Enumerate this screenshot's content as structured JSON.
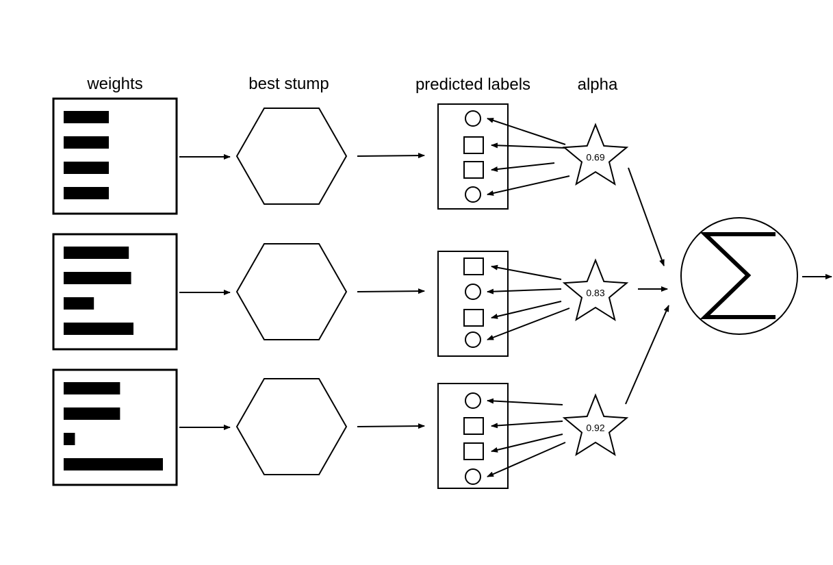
{
  "headers": {
    "weights": "weights",
    "best_stump": "best stump",
    "predicted_labels": "predicted labels",
    "alpha": "alpha"
  },
  "rounds": [
    {
      "weights": [
        0.25,
        0.25,
        0.25,
        0.25
      ],
      "labels": [
        "circle",
        "square",
        "square",
        "circle"
      ],
      "alpha": "0.69"
    },
    {
      "weights": [
        0.28,
        0.29,
        0.13,
        0.3
      ],
      "labels": [
        "square",
        "circle",
        "square",
        "circle"
      ],
      "alpha": "0.83"
    },
    {
      "weights": [
        0.25,
        0.25,
        0.05,
        0.44
      ],
      "labels": [
        "circle",
        "square",
        "square",
        "circle"
      ],
      "alpha": "0.92"
    }
  ],
  "combiner": {
    "icon": "sigma-sum-icon"
  },
  "colors": {
    "stroke": "#000000",
    "background": "#ffffff"
  }
}
